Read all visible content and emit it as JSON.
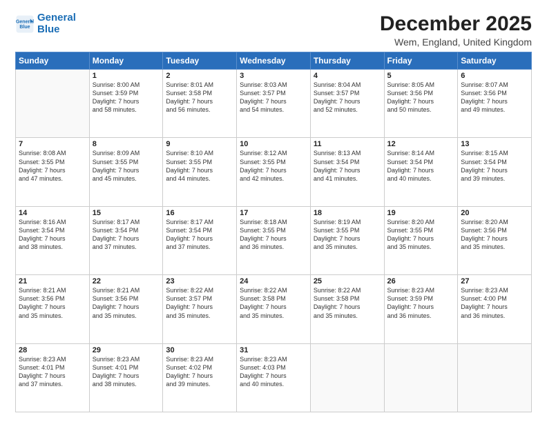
{
  "logo": {
    "line1": "General",
    "line2": "Blue"
  },
  "title": "December 2025",
  "subtitle": "Wem, England, United Kingdom",
  "days_header": [
    "Sunday",
    "Monday",
    "Tuesday",
    "Wednesday",
    "Thursday",
    "Friday",
    "Saturday"
  ],
  "weeks": [
    [
      {
        "num": "",
        "info": ""
      },
      {
        "num": "1",
        "info": "Sunrise: 8:00 AM\nSunset: 3:59 PM\nDaylight: 7 hours\nand 58 minutes."
      },
      {
        "num": "2",
        "info": "Sunrise: 8:01 AM\nSunset: 3:58 PM\nDaylight: 7 hours\nand 56 minutes."
      },
      {
        "num": "3",
        "info": "Sunrise: 8:03 AM\nSunset: 3:57 PM\nDaylight: 7 hours\nand 54 minutes."
      },
      {
        "num": "4",
        "info": "Sunrise: 8:04 AM\nSunset: 3:57 PM\nDaylight: 7 hours\nand 52 minutes."
      },
      {
        "num": "5",
        "info": "Sunrise: 8:05 AM\nSunset: 3:56 PM\nDaylight: 7 hours\nand 50 minutes."
      },
      {
        "num": "6",
        "info": "Sunrise: 8:07 AM\nSunset: 3:56 PM\nDaylight: 7 hours\nand 49 minutes."
      }
    ],
    [
      {
        "num": "7",
        "info": "Sunrise: 8:08 AM\nSunset: 3:55 PM\nDaylight: 7 hours\nand 47 minutes."
      },
      {
        "num": "8",
        "info": "Sunrise: 8:09 AM\nSunset: 3:55 PM\nDaylight: 7 hours\nand 45 minutes."
      },
      {
        "num": "9",
        "info": "Sunrise: 8:10 AM\nSunset: 3:55 PM\nDaylight: 7 hours\nand 44 minutes."
      },
      {
        "num": "10",
        "info": "Sunrise: 8:12 AM\nSunset: 3:55 PM\nDaylight: 7 hours\nand 42 minutes."
      },
      {
        "num": "11",
        "info": "Sunrise: 8:13 AM\nSunset: 3:54 PM\nDaylight: 7 hours\nand 41 minutes."
      },
      {
        "num": "12",
        "info": "Sunrise: 8:14 AM\nSunset: 3:54 PM\nDaylight: 7 hours\nand 40 minutes."
      },
      {
        "num": "13",
        "info": "Sunrise: 8:15 AM\nSunset: 3:54 PM\nDaylight: 7 hours\nand 39 minutes."
      }
    ],
    [
      {
        "num": "14",
        "info": "Sunrise: 8:16 AM\nSunset: 3:54 PM\nDaylight: 7 hours\nand 38 minutes."
      },
      {
        "num": "15",
        "info": "Sunrise: 8:17 AM\nSunset: 3:54 PM\nDaylight: 7 hours\nand 37 minutes."
      },
      {
        "num": "16",
        "info": "Sunrise: 8:17 AM\nSunset: 3:54 PM\nDaylight: 7 hours\nand 37 minutes."
      },
      {
        "num": "17",
        "info": "Sunrise: 8:18 AM\nSunset: 3:55 PM\nDaylight: 7 hours\nand 36 minutes."
      },
      {
        "num": "18",
        "info": "Sunrise: 8:19 AM\nSunset: 3:55 PM\nDaylight: 7 hours\nand 35 minutes."
      },
      {
        "num": "19",
        "info": "Sunrise: 8:20 AM\nSunset: 3:55 PM\nDaylight: 7 hours\nand 35 minutes."
      },
      {
        "num": "20",
        "info": "Sunrise: 8:20 AM\nSunset: 3:56 PM\nDaylight: 7 hours\nand 35 minutes."
      }
    ],
    [
      {
        "num": "21",
        "info": "Sunrise: 8:21 AM\nSunset: 3:56 PM\nDaylight: 7 hours\nand 35 minutes."
      },
      {
        "num": "22",
        "info": "Sunrise: 8:21 AM\nSunset: 3:56 PM\nDaylight: 7 hours\nand 35 minutes."
      },
      {
        "num": "23",
        "info": "Sunrise: 8:22 AM\nSunset: 3:57 PM\nDaylight: 7 hours\nand 35 minutes."
      },
      {
        "num": "24",
        "info": "Sunrise: 8:22 AM\nSunset: 3:58 PM\nDaylight: 7 hours\nand 35 minutes."
      },
      {
        "num": "25",
        "info": "Sunrise: 8:22 AM\nSunset: 3:58 PM\nDaylight: 7 hours\nand 35 minutes."
      },
      {
        "num": "26",
        "info": "Sunrise: 8:23 AM\nSunset: 3:59 PM\nDaylight: 7 hours\nand 36 minutes."
      },
      {
        "num": "27",
        "info": "Sunrise: 8:23 AM\nSunset: 4:00 PM\nDaylight: 7 hours\nand 36 minutes."
      }
    ],
    [
      {
        "num": "28",
        "info": "Sunrise: 8:23 AM\nSunset: 4:01 PM\nDaylight: 7 hours\nand 37 minutes."
      },
      {
        "num": "29",
        "info": "Sunrise: 8:23 AM\nSunset: 4:01 PM\nDaylight: 7 hours\nand 38 minutes."
      },
      {
        "num": "30",
        "info": "Sunrise: 8:23 AM\nSunset: 4:02 PM\nDaylight: 7 hours\nand 39 minutes."
      },
      {
        "num": "31",
        "info": "Sunrise: 8:23 AM\nSunset: 4:03 PM\nDaylight: 7 hours\nand 40 minutes."
      },
      {
        "num": "",
        "info": ""
      },
      {
        "num": "",
        "info": ""
      },
      {
        "num": "",
        "info": ""
      }
    ]
  ]
}
